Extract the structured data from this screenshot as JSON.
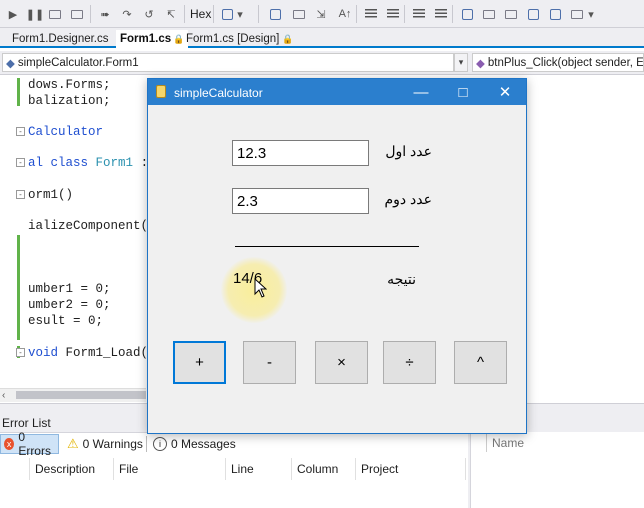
{
  "toolbar": {
    "hex_label": "Hex"
  },
  "tabs": [
    {
      "label": "Form1.Designer.cs"
    },
    {
      "label": "Form1.cs"
    },
    {
      "label": "Form1.cs [Design]"
    }
  ],
  "navbar": {
    "class_combo": "simpleCalculator.Form1",
    "member_combo": "btnPlus_Click(object sender, Ev"
  },
  "code": {
    "line1": "dows.Forms;",
    "line2": "balization;",
    "line3": "Calculator",
    "line4_kw": "al class",
    "line4_type": "Form1",
    "line4_rest": ":",
    "line5": "orm1()",
    "line6": "ializeComponent(",
    "line7": "umber1 = 0;",
    "line8": "umber2 = 0;",
    "line9": "esult = 0;",
    "line10_kw": "void",
    "line10_rest": "Form1_Load("
  },
  "error_list": {
    "title": "Error List",
    "errors": "0 Errors",
    "warnings": "0 Warnings",
    "messages": "0 Messages",
    "columns": [
      "Description",
      "File",
      "Line",
      "Column",
      "Project"
    ],
    "right_column": "Name"
  },
  "form": {
    "title": "simpleCalculator",
    "number1_label": "عدد اول",
    "number1_value": "12.3",
    "number2_label": "عدد دوم",
    "number2_value": "2.3",
    "result_label": "نتیجه",
    "result_value": "14/6",
    "buttons": [
      "+",
      "-",
      "×",
      "÷",
      "^"
    ]
  },
  "colors": {
    "accent": "#007acc",
    "titlebar": "#2b7fce",
    "keyword": "#1f4fd0",
    "type": "#2b91af"
  }
}
